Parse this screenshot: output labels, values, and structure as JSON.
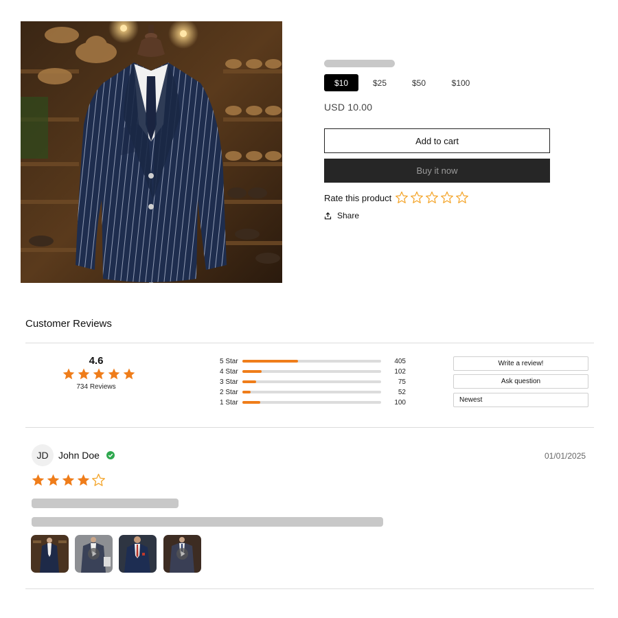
{
  "product": {
    "image_alt": "Navy pinstripe suit jacket on mannequin",
    "denominations": [
      {
        "label": "$10",
        "selected": true
      },
      {
        "label": "$25",
        "selected": false
      },
      {
        "label": "$50",
        "selected": false
      },
      {
        "label": "$100",
        "selected": false
      }
    ],
    "price": "USD 10.00",
    "add_to_cart_label": "Add to cart",
    "buy_now_label": "Buy it now",
    "rate_label": "Rate this product",
    "rate_stars": 5,
    "share_label": "Share",
    "share_icon": "share-icon"
  },
  "reviews": {
    "heading": "Customer Reviews",
    "average": "4.6",
    "average_stars": 5,
    "count_label": "734 Reviews",
    "distribution": [
      {
        "label": "5 Star",
        "count": "405",
        "fraction": 0.4
      },
      {
        "label": "4 Star",
        "count": "102",
        "fraction": 0.14
      },
      {
        "label": "3 Star",
        "count": "75",
        "fraction": 0.1
      },
      {
        "label": "2 Star",
        "count": "52",
        "fraction": 0.06
      },
      {
        "label": "1 Star",
        "count": "100",
        "fraction": 0.13
      }
    ],
    "write_review_label": "Write a review!",
    "ask_question_label": "Ask question",
    "sort_label": "Newest",
    "items": [
      {
        "initials": "JD",
        "name": "John Doe",
        "verified_icon": "verified-check-icon",
        "date": "01/01/2025",
        "rating": 4,
        "max_rating": 5,
        "media": [
          {
            "kind": "photo",
            "icon": ""
          },
          {
            "kind": "video",
            "icon": "play-icon"
          },
          {
            "kind": "photo",
            "icon": ""
          },
          {
            "kind": "video",
            "icon": "play-icon"
          }
        ]
      }
    ]
  },
  "colors": {
    "accent_orange": "#ef7d1a",
    "star_outline": "#f4a52a",
    "verified_green": "#2fa84f",
    "skeleton_gray": "#c8c8c8",
    "buy_now_bg": "#262626"
  }
}
